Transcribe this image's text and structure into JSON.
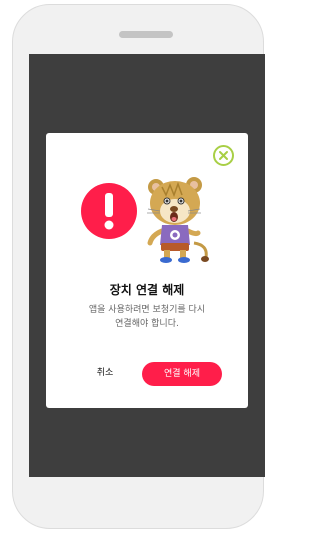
{
  "dialog": {
    "title": "장치 연결 해제",
    "message": "앱을 사용하려면 보청기를 다시\n연결해야 합니다.",
    "cancel_label": "취소",
    "confirm_label": "연결 해제"
  },
  "icons": {
    "close": "close-icon",
    "warning": "exclamation-warning-icon",
    "mascot": "lion-mascot-illustration"
  },
  "colors": {
    "accent": "#ff1e4a",
    "close_ring": "#a8cf45",
    "overlay": "#3e3e3e",
    "phone_frame": "#f1f1f1"
  }
}
